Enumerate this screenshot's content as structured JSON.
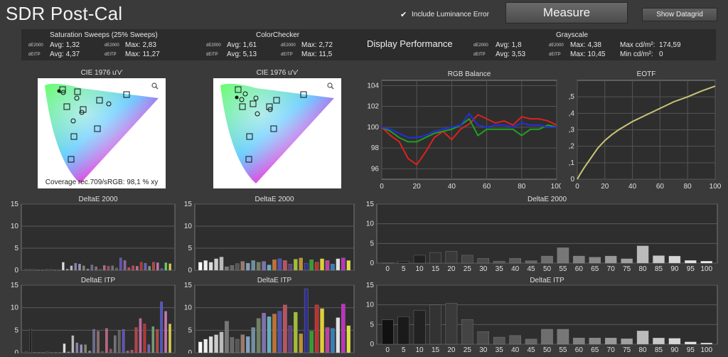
{
  "header": {
    "title": "SDR Post-Cal",
    "luminance_checkbox_label": "Include Luminance Error",
    "luminance_checked": true,
    "measure_label": "Measure",
    "datagrid_label": "Show Datagrid"
  },
  "summary": {
    "saturation": {
      "title": "Saturation Sweeps (25% Sweeps)",
      "de2000_label": "dE2000",
      "ditp_label": "dEITP",
      "avg_2000": "Avg: 1,32",
      "max_2000": "Max: 2,83",
      "avg_itp": "Avg: 4,37",
      "max_itp": "Max: 11,27"
    },
    "colorchecker": {
      "title": "ColorChecker",
      "de2000_label": "dE2000",
      "ditp_label": "dEITP",
      "avg_2000": "Avg: 1,61",
      "max_2000": "Max: 2,72",
      "avg_itp": "Avg: 5,13",
      "max_itp": "Max: 11,5"
    },
    "display_performance": "Display Performance",
    "grayscale": {
      "title": "Grayscale",
      "de2000_label": "dE2000",
      "ditp_label": "dEITP",
      "avg_2000": "Avg: 1,8",
      "max_2000": "Max: 4,38",
      "avg_itp": "Avg: 3,53",
      "max_itp": "Max: 10,45",
      "max_lum_label": "Max cd/m²:",
      "max_lum": "174,59",
      "min_lum_label": "Min cd/m²:",
      "min_lum": "0"
    }
  },
  "cie": {
    "left_title": "CIE 1976 u'v'",
    "right_title": "CIE 1976 u'v'",
    "coverage": "Coverage rec.709/sRGB:  98,1 % xy",
    "zoom_icon": "magnifier-icon"
  },
  "chart_data": [
    {
      "type": "line",
      "title": "RGB Balance",
      "x": [
        0,
        5,
        10,
        15,
        20,
        25,
        30,
        35,
        40,
        45,
        50,
        55,
        60,
        65,
        70,
        75,
        80,
        85,
        90,
        95,
        100
      ],
      "xlim": [
        0,
        100
      ],
      "ylim": [
        95,
        104.5
      ],
      "xticks": [
        0,
        20,
        40,
        60,
        80,
        100
      ],
      "yticks": [
        96,
        98,
        100,
        102,
        104
      ],
      "series": [
        {
          "color": "#e02020",
          "values": [
            100,
            99.2,
            98.6,
            97.0,
            96.4,
            97.6,
            99.0,
            99.6,
            98.8,
            99.8,
            100.3,
            101.2,
            100.8,
            100.4,
            100.6,
            100.2,
            101.0,
            100.8,
            100.8,
            100.6,
            100.2
          ]
        },
        {
          "color": "#20a020",
          "values": [
            100,
            99.6,
            99.0,
            98.6,
            98.6,
            99.0,
            99.4,
            99.6,
            99.8,
            100.2,
            100.8,
            99.2,
            99.8,
            99.8,
            99.8,
            99.8,
            99.2,
            99.8,
            99.8,
            100.2,
            100.0
          ]
        },
        {
          "color": "#2030e0",
          "values": [
            100,
            99.8,
            99.4,
            99.0,
            99.0,
            99.2,
            99.6,
            99.8,
            100.0,
            100.2,
            101.3,
            100.2,
            100.0,
            100.2,
            100.2,
            100.0,
            100.4,
            100.2,
            100.2,
            100.0,
            100.0
          ]
        }
      ]
    },
    {
      "type": "line",
      "title": "EOTF",
      "xlim": [
        0,
        100
      ],
      "ylim": [
        0,
        0.6
      ],
      "xticks": [
        0,
        20,
        40,
        60,
        80,
        100
      ],
      "yticks": [
        0,
        0.1,
        0.2,
        0.3,
        0.4,
        0.5
      ],
      "ytick_labels": [
        "0",
        ",1",
        ",2",
        ",3",
        ",4",
        ",5"
      ],
      "x": [
        0,
        2,
        5,
        10,
        15,
        20,
        25,
        30,
        40,
        50,
        60,
        70,
        80,
        90,
        100
      ],
      "series": [
        {
          "color": "#c8c478",
          "values": [
            0,
            0.03,
            0.07,
            0.13,
            0.19,
            0.235,
            0.27,
            0.3,
            0.35,
            0.39,
            0.43,
            0.47,
            0.5,
            0.535,
            0.565
          ]
        }
      ]
    },
    {
      "type": "bar",
      "title": "DeltaE 2000",
      "ylim": [
        0,
        15
      ],
      "yticks": [
        0,
        5,
        10,
        15
      ],
      "values": [
        0.2,
        0.2,
        0.2,
        0.1,
        0.1,
        0.2,
        0.2,
        0.1,
        0.1,
        1.8,
        0.3,
        1.0,
        1.6,
        1.4,
        1.0,
        0.3,
        1.2,
        0.8,
        0.2,
        1.1,
        0.9,
        1.0,
        0.5,
        2.8,
        2.2,
        0.6,
        1.0,
        0.9,
        1.8,
        1.6,
        0.9,
        1.8,
        1.7,
        0.4,
        1.7,
        1.5
      ],
      "colors": [
        "#222",
        "#222",
        "#222",
        "#222",
        "#222",
        "#222",
        "#222",
        "#222",
        "#222",
        "#ddd",
        "#999",
        "#bbb",
        "#8a7fb0",
        "#a090c0",
        "#7a8a70",
        "#888",
        "#6a6a90",
        "#8a6a6a",
        "#444",
        "#c06080",
        "#a04070",
        "#707070",
        "#606060",
        "#6050c0",
        "#9060a0",
        "#d04060",
        "#c04040",
        "#d060a0",
        "#c03030",
        "#7060c0",
        "#70a070",
        "#c04040",
        "#d070b0",
        "#5050d0",
        "#60d060",
        "#d8d040"
      ]
    },
    {
      "type": "bar",
      "title": "DeltaE 2000",
      "ylim": [
        0,
        15
      ],
      "yticks": [
        0,
        5,
        10,
        15
      ],
      "values": [
        1.8,
        2.2,
        1.8,
        2.6,
        3.0,
        0.8,
        1.1,
        1.5,
        2.0,
        1.6,
        2.2,
        1.8,
        2.0,
        1.2,
        2.4,
        2.6,
        2.2,
        1.4,
        2.5,
        2.8,
        1.6,
        2.4,
        1.8,
        2.6,
        2.2,
        1.4,
        2.6,
        2.8,
        2.2
      ],
      "colors": [
        "#fff",
        "#eee",
        "#ddd",
        "#ccc",
        "#bbb",
        "#777",
        "#666",
        "#555",
        "#9a7a6a",
        "#80a0c0",
        "#7090a0",
        "#708060",
        "#8070b0",
        "#60b0c0",
        "#c07030",
        "#5050b0",
        "#c05060",
        "#604080",
        "#a0c030",
        "#c09030",
        "#303090",
        "#30a030",
        "#c03030",
        "#e0d030",
        "#c040a0",
        "#3080c0",
        "#e0e0e0",
        "#c030c0",
        "#e0e040"
      ]
    },
    {
      "type": "bar",
      "title": "DeltaE 2000",
      "categories": [
        "0",
        "5",
        "10",
        "15",
        "20",
        "25",
        "30",
        "35",
        "40",
        "45",
        "50",
        "55",
        "60",
        "65",
        "70",
        "75",
        "80",
        "85",
        "90",
        "95",
        "100"
      ],
      "ylim": [
        0,
        15
      ],
      "yticks": [
        0,
        5,
        10,
        15
      ],
      "values": [
        0.1,
        0.5,
        2.0,
        2.7,
        3.0,
        2.0,
        1.2,
        0.5,
        1.2,
        0.6,
        1.8,
        3.9,
        1.8,
        1.5,
        1.8,
        1.1,
        4.4,
        1.9,
        1.8,
        0.7,
        0.5
      ],
      "colors": [
        "#111",
        "#1a1a1a",
        "#222",
        "#333",
        "#3a3a3a",
        "#444",
        "#4a4a4a",
        "#555",
        "#5a5a5a",
        "#666",
        "#6e6e6e",
        "#777",
        "#808080",
        "#888",
        "#999",
        "#a0a0a0",
        "#bbb",
        "#c8c8c8",
        "#d6d6d6",
        "#e4e4e4",
        "#f2f2f2"
      ]
    },
    {
      "type": "bar",
      "title": "DeltaE ITP",
      "ylim": [
        0,
        15
      ],
      "yticks": [
        0,
        5,
        10,
        15
      ],
      "values": [
        0.2,
        5.2,
        0.1,
        0.1,
        0.1,
        0.2,
        0.1,
        0.1,
        0.1,
        2.0,
        0.2,
        3.8,
        2.2,
        1.8,
        1.8,
        0.4,
        5.2,
        4.8,
        0.3,
        5.4,
        0.8,
        3.8,
        5.0,
        5.2,
        0.4,
        0.6,
        5.6,
        7.6,
        6.4,
        1.8,
        5.8,
        5.2,
        11.3,
        9.2,
        6.4
      ],
      "colors": [
        "#222",
        "#222",
        "#222",
        "#222",
        "#222",
        "#222",
        "#222",
        "#222",
        "#222",
        "#ddd",
        "#999",
        "#bbb",
        "#8a7fb0",
        "#a090c0",
        "#7a8a70",
        "#888",
        "#6a6a90",
        "#8a6a6a",
        "#444",
        "#c06080",
        "#a04070",
        "#707070",
        "#606060",
        "#6050c0",
        "#9060a0",
        "#d04060",
        "#c04040",
        "#d060a0",
        "#c03030",
        "#7060c0",
        "#70a070",
        "#c04040",
        "#5050d0",
        "#d070b0",
        "#d8d040"
      ]
    },
    {
      "type": "bar",
      "title": "DeltaE ITP",
      "ylim": [
        0,
        15
      ],
      "yticks": [
        0,
        5,
        10,
        15
      ],
      "values": [
        2.4,
        3.0,
        3.6,
        4.0,
        4.6,
        7.0,
        3.4,
        3.0,
        4.0,
        3.6,
        5.6,
        7.6,
        8.8,
        8.0,
        8.6,
        9.2,
        10.6,
        6.0,
        9.0,
        4.2,
        14.2,
        4.8,
        10.6,
        9.8,
        5.6,
        5.4,
        7.8,
        10.8,
        6.0
      ],
      "colors": [
        "#fff",
        "#eee",
        "#ddd",
        "#ccc",
        "#bbb",
        "#777",
        "#666",
        "#555",
        "#9a7a6a",
        "#80a0c0",
        "#7090a0",
        "#708060",
        "#8070b0",
        "#60b0c0",
        "#c07030",
        "#5050b0",
        "#c05060",
        "#604080",
        "#a0c030",
        "#c09030",
        "#303090",
        "#30a030",
        "#c03030",
        "#e0d030",
        "#c040a0",
        "#3080c0",
        "#e0e0e0",
        "#c030c0",
        "#e0e040"
      ]
    },
    {
      "type": "bar",
      "title": "DeltaE ITP",
      "categories": [
        "0",
        "5",
        "10",
        "15",
        "20",
        "25",
        "30",
        "35",
        "40",
        "45",
        "50",
        "55",
        "60",
        "65",
        "70",
        "75",
        "80",
        "85",
        "90",
        "95",
        "100"
      ],
      "ylim": [
        0,
        15
      ],
      "yticks": [
        0,
        5,
        10,
        15
      ],
      "values": [
        6.2,
        7.0,
        8.6,
        10.0,
        10.4,
        6.3,
        3.2,
        1.8,
        2.2,
        1.3,
        3.8,
        3.8,
        1.6,
        1.6,
        1.6,
        1.4,
        3.4,
        1.6,
        1.5,
        0.6,
        0.3
      ],
      "colors": [
        "#111",
        "#1a1a1a",
        "#222",
        "#333",
        "#3a3a3a",
        "#444",
        "#4a4a4a",
        "#555",
        "#5a5a5a",
        "#666",
        "#6e6e6e",
        "#777",
        "#808080",
        "#888",
        "#999",
        "#a0a0a0",
        "#bbb",
        "#c8c8c8",
        "#d6d6d6",
        "#e4e4e4",
        "#f2f2f2"
      ]
    }
  ]
}
